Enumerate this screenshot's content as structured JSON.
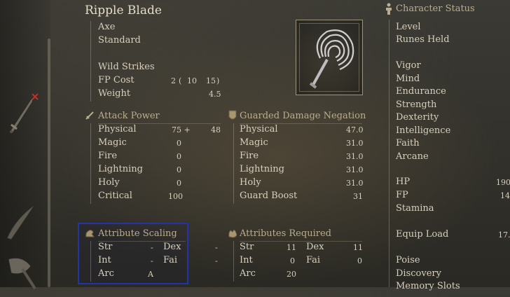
{
  "weapon": {
    "name": "Ripple Blade",
    "type": "Axe",
    "attack_type": "Standard",
    "skill": "Wild Strikes",
    "fp_cost_label": "FP Cost",
    "fp_cost_a": "2",
    "fp_cost_b": "10",
    "fp_cost_c": "15",
    "fp_open": "(",
    "fp_close": ")",
    "weight_label": "Weight",
    "weight_value": "4.5"
  },
  "attack_power": {
    "header": "Attack Power",
    "rows": [
      {
        "label": "Physical",
        "value": "75 +",
        "bonus": "48"
      },
      {
        "label": "Magic",
        "value": "0",
        "bonus": ""
      },
      {
        "label": "Fire",
        "value": "0",
        "bonus": ""
      },
      {
        "label": "Lightning",
        "value": "0",
        "bonus": ""
      },
      {
        "label": "Holy",
        "value": "0",
        "bonus": ""
      },
      {
        "label": "Critical",
        "value": "100",
        "bonus": ""
      }
    ]
  },
  "guard": {
    "header": "Guarded Damage Negation",
    "rows": [
      {
        "label": "Physical",
        "value": "47.0"
      },
      {
        "label": "Magic",
        "value": "31.0"
      },
      {
        "label": "Fire",
        "value": "31.0"
      },
      {
        "label": "Lightning",
        "value": "31.0"
      },
      {
        "label": "Holy",
        "value": "31.0"
      },
      {
        "label": "Guard Boost",
        "value": "31"
      }
    ]
  },
  "scaling": {
    "header": "Attribute Scaling",
    "str_label": "Str",
    "str_value": "-",
    "dex_label": "Dex",
    "dex_value": "-",
    "int_label": "Int",
    "int_value": "-",
    "fai_label": "Fai",
    "fai_value": "-",
    "arc_label": "Arc",
    "arc_value": "A"
  },
  "required": {
    "header": "Attributes Required",
    "str_label": "Str",
    "str_value": "11",
    "dex_label": "Dex",
    "dex_value": "11",
    "int_label": "Int",
    "int_value": "0",
    "fai_label": "Fai",
    "fai_value": "0",
    "arc_label": "Arc",
    "arc_value": "20"
  },
  "status": {
    "header": "Character Status",
    "level": "Level",
    "runes": "Runes Held",
    "vigor": "Vigor",
    "mind": "Mind",
    "endurance": "Endurance",
    "strength": "Strength",
    "dexterity": "Dexterity",
    "intelligence": "Intelligence",
    "faith": "Faith",
    "arcane": "Arcane",
    "hp_label": "HP",
    "hp_value": "190",
    "fp_label": "FP",
    "fp_value": "14",
    "stamina": "Stamina",
    "equip_label": "Equip Load",
    "equip_value": "17.",
    "poise": "Poise",
    "discovery": "Discovery",
    "memory": "Memory Slots"
  },
  "colors": {
    "focus_border": "#2234a8",
    "header_text": "#b9ae8f",
    "body_text": "#d8d0bc",
    "remove_mark": "#c0302a"
  },
  "icons": [
    "sword-icon",
    "shield-icon",
    "arm-flex-icon",
    "hand-icon",
    "person-icon",
    "ripple-blade-icon",
    "remove-x-icon"
  ]
}
